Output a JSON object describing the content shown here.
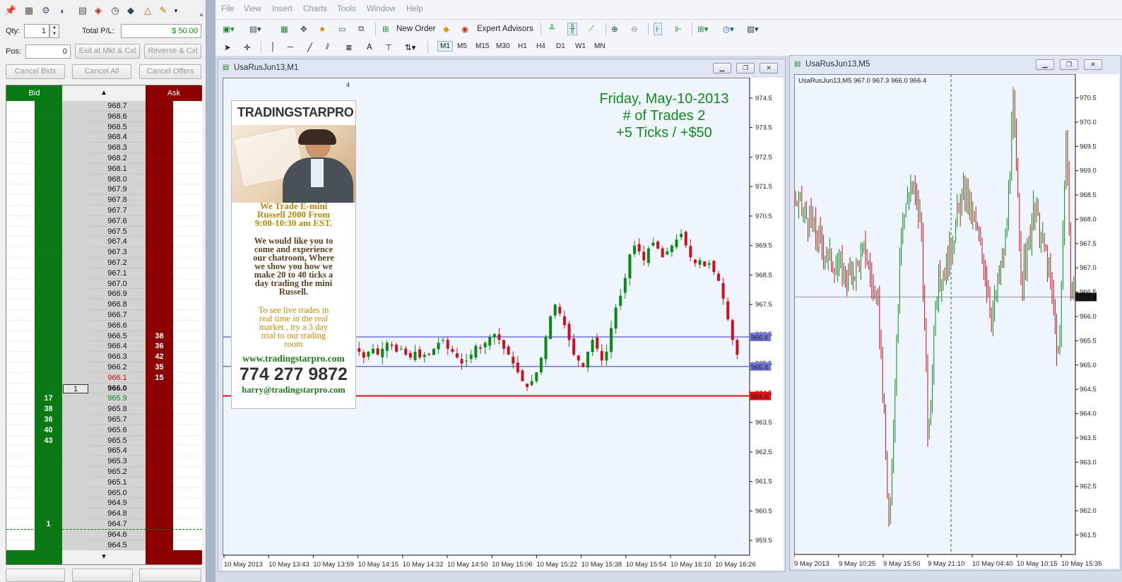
{
  "dom": {
    "qty_label": "Qty:",
    "qty_value": "1",
    "total_pl_label": "Total P/L:",
    "total_pl_value": "$ 50.00",
    "pos_label": "Pos:",
    "pos_value": "0",
    "exit_button": "Exit at Mkt & Cxl",
    "reverse_button": "Reverse & Cxl",
    "cancel_bids": "Cancel Bids",
    "cancel_all": "Cancel All",
    "cancel_offers": "Cancel Offers",
    "bid_header": "Bid",
    "ask_header": "Ask",
    "up_arrow": "▲",
    "down_arrow": "▼",
    "rows": [
      {
        "price": "968.7",
        "bid": "",
        "ask": ""
      },
      {
        "price": "968.6",
        "bid": "",
        "ask": ""
      },
      {
        "price": "968.5",
        "bid": "",
        "ask": ""
      },
      {
        "price": "968.4",
        "bid": "",
        "ask": ""
      },
      {
        "price": "968.3",
        "bid": "",
        "ask": ""
      },
      {
        "price": "968.2",
        "bid": "",
        "ask": ""
      },
      {
        "price": "968.1",
        "bid": "",
        "ask": ""
      },
      {
        "price": "968.0",
        "bid": "",
        "ask": ""
      },
      {
        "price": "967.9",
        "bid": "",
        "ask": ""
      },
      {
        "price": "967.8",
        "bid": "",
        "ask": ""
      },
      {
        "price": "967.7",
        "bid": "",
        "ask": ""
      },
      {
        "price": "967.6",
        "bid": "",
        "ask": ""
      },
      {
        "price": "967.5",
        "bid": "",
        "ask": ""
      },
      {
        "price": "967.4",
        "bid": "",
        "ask": ""
      },
      {
        "price": "967.3",
        "bid": "",
        "ask": ""
      },
      {
        "price": "967.2",
        "bid": "",
        "ask": ""
      },
      {
        "price": "967.1",
        "bid": "",
        "ask": ""
      },
      {
        "price": "967.0",
        "bid": "",
        "ask": ""
      },
      {
        "price": "966.9",
        "bid": "",
        "ask": ""
      },
      {
        "price": "966.8",
        "bid": "",
        "ask": ""
      },
      {
        "price": "966.7",
        "bid": "",
        "ask": ""
      },
      {
        "price": "966.6",
        "bid": "",
        "ask": ""
      },
      {
        "price": "966.5",
        "bid": "",
        "ask": "38"
      },
      {
        "price": "966.4",
        "bid": "",
        "ask": "36"
      },
      {
        "price": "966.3",
        "bid": "",
        "ask": "42"
      },
      {
        "price": "966.2",
        "bid": "",
        "ask": "35"
      },
      {
        "price": "966.1",
        "bid": "",
        "ask": "15",
        "style": "ask"
      },
      {
        "price": "966.0",
        "bid": "",
        "ask": "",
        "style": "last",
        "order": "1"
      },
      {
        "price": "965.9",
        "bid": "17",
        "ask": "",
        "style": "bid"
      },
      {
        "price": "965.8",
        "bid": "38",
        "ask": ""
      },
      {
        "price": "965.7",
        "bid": "36",
        "ask": ""
      },
      {
        "price": "965.6",
        "bid": "40",
        "ask": ""
      },
      {
        "price": "965.5",
        "bid": "43",
        "ask": ""
      },
      {
        "price": "965.4",
        "bid": "",
        "ask": ""
      },
      {
        "price": "965.3",
        "bid": "",
        "ask": ""
      },
      {
        "price": "965.2",
        "bid": "",
        "ask": ""
      },
      {
        "price": "965.1",
        "bid": "",
        "ask": ""
      },
      {
        "price": "965.0",
        "bid": "",
        "ask": ""
      },
      {
        "price": "964.9",
        "bid": "",
        "ask": ""
      },
      {
        "price": "964.8",
        "bid": "",
        "ask": ""
      },
      {
        "price": "964.7",
        "bid": "1",
        "ask": ""
      },
      {
        "price": "964.6",
        "bid": "",
        "ask": ""
      },
      {
        "price": "964.5",
        "bid": "",
        "ask": ""
      }
    ]
  },
  "menu": [
    "File",
    "View",
    "Insert",
    "Charts",
    "Tools",
    "Window",
    "Help"
  ],
  "toolbar": {
    "new_order": "New Order",
    "expert_advisors": "Expert Advisors",
    "timeframes": [
      "M1",
      "M5",
      "M15",
      "M30",
      "H1",
      "H4",
      "D1",
      "W1",
      "MN"
    ]
  },
  "chart1": {
    "title": "UsaRusJun13,M1",
    "overlay_line1": "Friday, May-10-2013",
    "overlay_line2": "# of Trades 2",
    "overlay_line3": "+5 Ticks / +$50",
    "stray_label": "4",
    "y_ticks": [
      "974.5",
      "973.5",
      "972.5",
      "971.5",
      "970.5",
      "969.5",
      "968.5",
      "967.5",
      "966.5",
      "965.5",
      "964.5",
      "963.5",
      "962.5",
      "961.5",
      "960.5",
      "959.5"
    ],
    "x_ticks": [
      "10 May 2013",
      "10 May 13:43",
      "10 May 13:59",
      "10 May 14:15",
      "10 May 14:32",
      "10 May 14:50",
      "10 May 15:06",
      "10 May 15:22",
      "10 May 15:38",
      "10 May 15:54",
      "10 May 16:10",
      "10 May 16:26"
    ],
    "price_tags": [
      {
        "label": "966.4",
        "color": "#6f73d6"
      },
      {
        "label": "965.4",
        "color": "#6f73d6"
      },
      {
        "label": "964.4",
        "color": "#e01010"
      }
    ]
  },
  "chart2": {
    "title": "UsaRusJun13,M5",
    "info": "UsaRusJun13,M5  967.0 967.3 966.0 966.4",
    "y_ticks": [
      "970.5",
      "970.0",
      "969.5",
      "969.0",
      "968.5",
      "968.0",
      "967.5",
      "967.0",
      "966.5",
      "966.0",
      "965.5",
      "965.0",
      "964.5",
      "964.0",
      "963.5",
      "963.0",
      "962.5",
      "962.0",
      "961.5"
    ],
    "x_ticks": [
      "9 May 2013",
      "9 May 10:25",
      "9 May 15:50",
      "9 May 21:10",
      "10 May 04:40",
      "10 May 10:15",
      "10 May 15:35"
    ],
    "price_tag": "966.4"
  },
  "ad": {
    "logo": "TRADINGSTARPRO",
    "line1": "We Trade E-mini",
    "line2": "Russell 2000 From",
    "line3": "9:00-10:30 am EST.",
    "p2": [
      "We would like you to",
      "come and experience",
      "our chatroom, Where",
      "we show you how we",
      "make 20 to 40 ticks a",
      "day trading the mini",
      "Russell."
    ],
    "p3": [
      "To see live trades in",
      "real time in the real",
      "market , try a 3 day",
      "trial to our trading",
      "room"
    ],
    "url": "www.tradingstarpro.com",
    "phone": "774 277 9872",
    "email": "harry@tradingstarpro.com"
  },
  "colors": {
    "bid_green": "#0a7a14",
    "ask_red": "#8c0000",
    "overlay_green": "#138a1b",
    "bull": "#0a8a14",
    "bear": "#cc1020"
  }
}
